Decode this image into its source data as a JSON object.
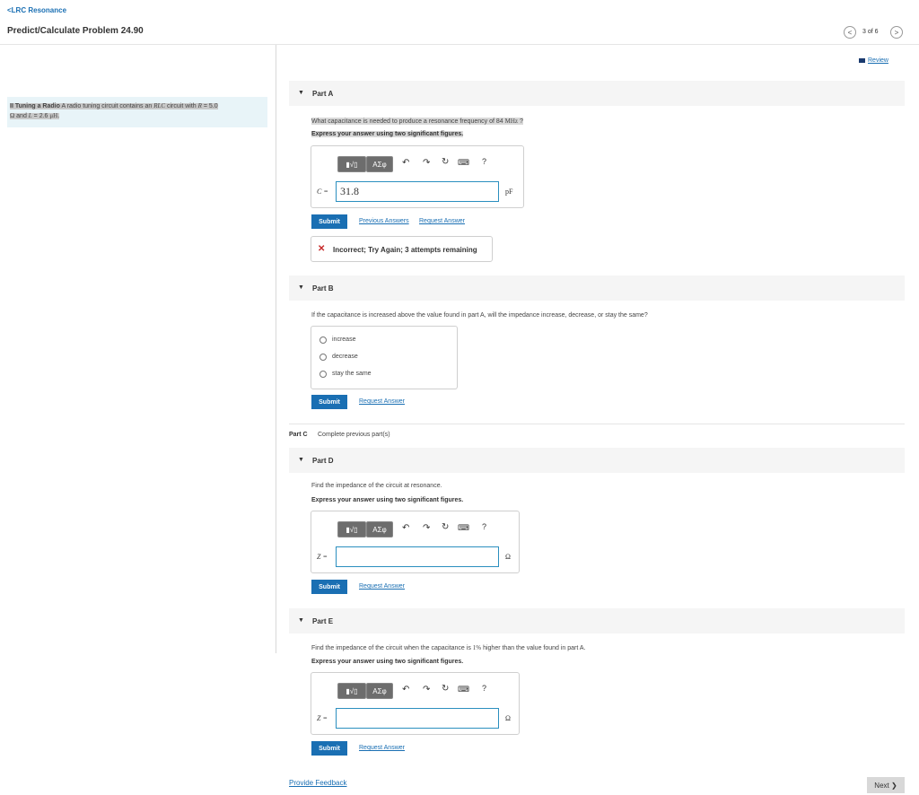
{
  "header": {
    "back_link": "LRC Resonance",
    "title": "Predict/Calculate Problem 24.90",
    "pager": {
      "count": "3 of 6",
      "prev_icon": "chevron-left-icon",
      "next_icon": "chevron-right-icon"
    },
    "review_link": "Review"
  },
  "intro": {
    "badge": "II",
    "lead": "Tuning a Radio",
    "text_a": "A radio tuning circuit contains an",
    "circuit": "RLC",
    "text_b": "circuit with",
    "r_sym": "R",
    "r_val": "= 5.0",
    "ohm": "Ω",
    "text_c": "and",
    "l_sym": "L",
    "l_val": "= 2.6",
    "l_unit": "μH",
    "period": "."
  },
  "part_a": {
    "title": "Part A",
    "question": "What capacitance is needed to produce a resonance frequency of 84",
    "question_unit": "MHz",
    "question_end": "?",
    "instruction": "Express your answer using two significant figures.",
    "toolbar": {
      "templates": "▮√▯",
      "greek": "ΑΣφ",
      "help": "?"
    },
    "var": "C =",
    "value": "31.8",
    "unit": "pF",
    "submit": "Submit",
    "prev_answers": "Previous Answers",
    "request_answer": "Request Answer",
    "feedback": "Incorrect; Try Again; 3 attempts remaining"
  },
  "part_b": {
    "title": "Part B",
    "question": "If the capacitance is increased above the value found in part A, will the impedance increase, decrease, or stay the same?",
    "options": [
      "increase",
      "decrease",
      "stay the same"
    ],
    "submit": "Submit",
    "request_answer": "Request Answer"
  },
  "part_c": {
    "title": "Part C",
    "status": "Complete previous part(s)"
  },
  "part_d": {
    "title": "Part D",
    "question": "Find the impedance of the circuit at resonance.",
    "instruction": "Express your answer using two significant figures.",
    "toolbar": {
      "templates": "▮√▯",
      "greek": "ΑΣφ",
      "help": "?"
    },
    "var": "Z =",
    "value": "",
    "unit": "Ω",
    "submit": "Submit",
    "request_answer": "Request Answer"
  },
  "part_e": {
    "title": "Part E",
    "question": "Find the impedance of the circuit when the capacitance is",
    "question_pct": "1%",
    "question_end": "higher than the value found in part A.",
    "instruction": "Express your answer using two significant figures.",
    "toolbar": {
      "templates": "▮√▯",
      "greek": "ΑΣφ",
      "help": "?"
    },
    "var": "Z =",
    "value": "",
    "unit": "Ω",
    "submit": "Submit",
    "request_answer": "Request Answer"
  },
  "footer": {
    "feedback_link": "Provide Feedback",
    "next": "Next"
  },
  "colors": {
    "accent": "#1a6fb3",
    "error": "#c62828",
    "intro_bg": "#e8f4f8"
  }
}
